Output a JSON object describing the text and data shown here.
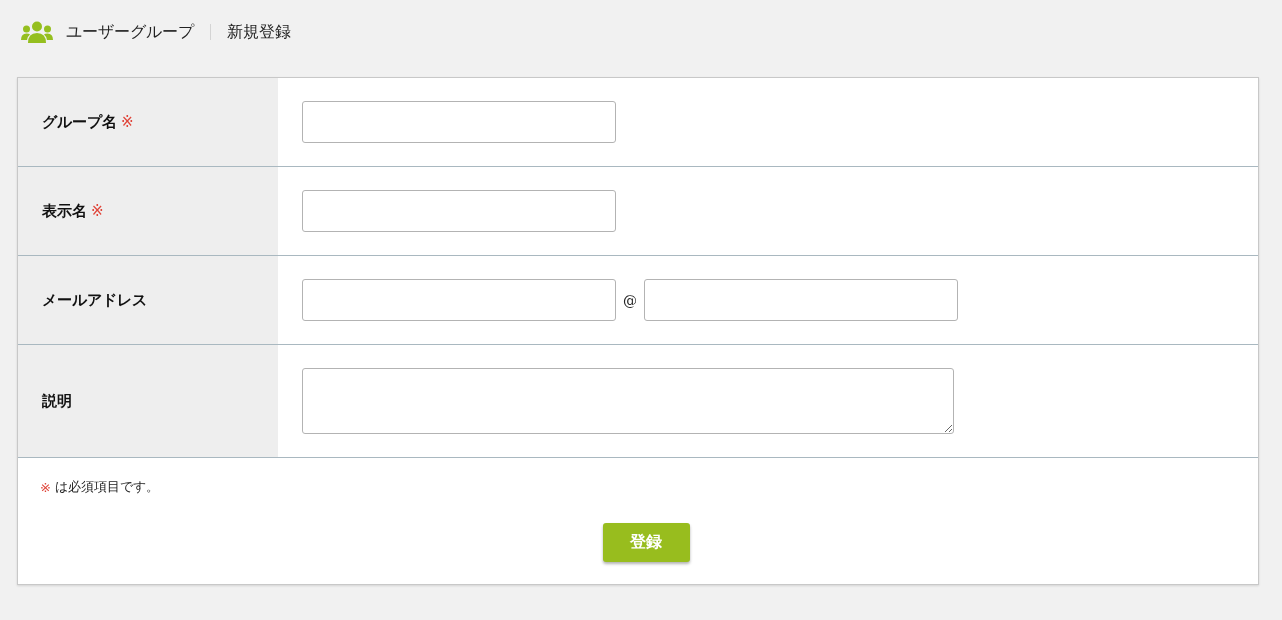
{
  "header": {
    "section": "ユーザーグループ",
    "page": "新規登録"
  },
  "required_mark": "※",
  "rows": [
    {
      "label": "グループ名",
      "required": true,
      "kind": "text"
    },
    {
      "label": "表示名",
      "required": true,
      "kind": "text"
    },
    {
      "label": "メールアドレス",
      "required": false,
      "kind": "email",
      "separator": "@"
    },
    {
      "label": "説明",
      "required": false,
      "kind": "textarea"
    }
  ],
  "note": "は必須項目です。",
  "submit": "登録"
}
